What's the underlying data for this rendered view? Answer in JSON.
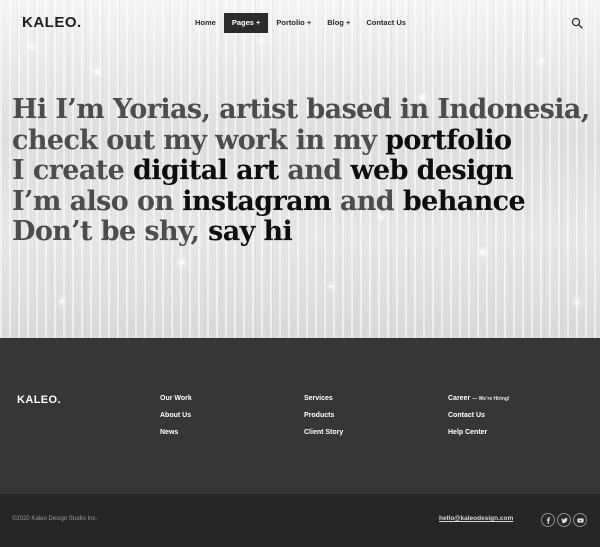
{
  "header": {
    "logo": "KALEO.",
    "nav": [
      {
        "label": "Home"
      },
      {
        "label": "Pages +"
      },
      {
        "label": "Portolio +"
      },
      {
        "label": "Blog +"
      },
      {
        "label": "Contact Us"
      }
    ],
    "active_nav": "Pages +",
    "search_icon": "search-icon"
  },
  "hero": {
    "lines": [
      {
        "plain": "Hi I’m Yorias, artist based in Indonesia,"
      },
      {
        "plain": "check out my work in my ",
        "hl": "portfolio"
      },
      {
        "pre": "I create ",
        "hl1": "digital art",
        "mid": " and ",
        "hl2": "web design"
      },
      {
        "pre": "I’m also on ",
        "hl1": "instagram",
        "mid": " and ",
        "hl2": "behance"
      },
      {
        "pre": "Don’t be shy, ",
        "hl": "say hi"
      }
    ]
  },
  "footer": {
    "logo": "KALEO.",
    "col1": [
      "Our Work",
      "About Us",
      "News"
    ],
    "col2": [
      "Services",
      "Products",
      "Client Story"
    ],
    "col3": [
      {
        "label": "Career",
        "note": "— We’re Hiring!"
      },
      {
        "label": "Contact Us"
      },
      {
        "label": "Help Center"
      }
    ]
  },
  "bottom": {
    "copyright": "©2020 Kaleo Design Studio Inc.",
    "email": "hello@kaleodesign.com",
    "social": [
      "facebook-icon",
      "twitter-icon",
      "youtube-icon"
    ]
  },
  "colors": {
    "footer_bg": "#363636",
    "bottom_bar_bg": "#262626",
    "active_nav_bg": "#2b2b2b",
    "headline_muted": "#4d4d4d",
    "headline_highlight": "#0d0d0d"
  }
}
